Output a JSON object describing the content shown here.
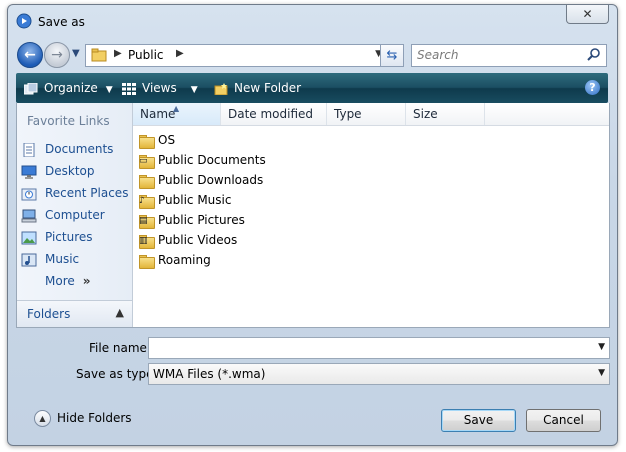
{
  "window": {
    "title": "Save as",
    "close_label": "✕"
  },
  "nav": {
    "address_path": [
      "Public"
    ],
    "search_placeholder": "Search"
  },
  "toolbar": {
    "organize_label": "Organize",
    "views_label": "Views",
    "new_folder_label": "New Folder",
    "help_label": "?"
  },
  "sidebar": {
    "header": "Favorite Links",
    "items": [
      {
        "label": "Documents",
        "icon": "documents-icon"
      },
      {
        "label": "Desktop",
        "icon": "desktop-icon"
      },
      {
        "label": "Recent Places",
        "icon": "recent-places-icon"
      },
      {
        "label": "Computer",
        "icon": "computer-icon"
      },
      {
        "label": "Pictures",
        "icon": "pictures-icon"
      },
      {
        "label": "Music",
        "icon": "music-icon"
      }
    ],
    "more_label": "More",
    "more_arrow": "»",
    "folders_label": "Folders"
  },
  "columns": [
    "Name",
    "Date modified",
    "Type",
    "Size"
  ],
  "files": [
    {
      "name": "OS",
      "icon": "folder-icon"
    },
    {
      "name": "Public Documents",
      "icon": "folder-documents-icon"
    },
    {
      "name": "Public Downloads",
      "icon": "folder-icon"
    },
    {
      "name": "Public Music",
      "icon": "folder-music-icon"
    },
    {
      "name": "Public Pictures",
      "icon": "folder-pictures-icon"
    },
    {
      "name": "Public Videos",
      "icon": "folder-videos-icon"
    },
    {
      "name": "Roaming",
      "icon": "folder-icon"
    }
  ],
  "form": {
    "filename_label": "File name:",
    "filename_value": "",
    "savetype_label": "Save as type:",
    "savetype_value": "WMA Files (*.wma)"
  },
  "buttons": {
    "hide_folders": "Hide Folders",
    "save": "Save",
    "cancel": "Cancel"
  },
  "colors": {
    "toolbar": "#1b4e62",
    "link": "#1d4f91",
    "chrome": "#c9d7e7"
  }
}
